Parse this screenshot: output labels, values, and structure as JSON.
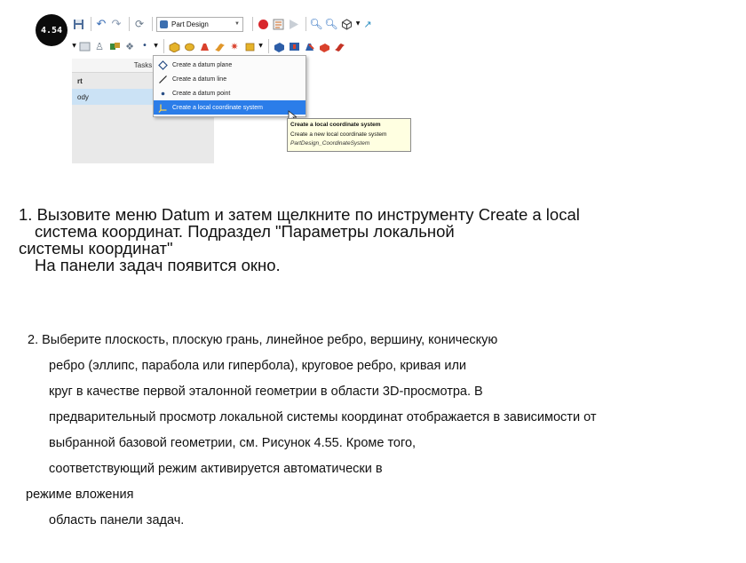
{
  "screenshot": {
    "badge": "4.54",
    "toolbar": {
      "workbench_label": "Part Design"
    },
    "tasks_panel": {
      "header": "Tasks",
      "rows": [
        "rt",
        "ody"
      ]
    },
    "datum_menu": {
      "items": [
        {
          "label": "Create a datum plane",
          "icon": "datum-plane-icon",
          "highlighted": false
        },
        {
          "label": "Create a datum line",
          "icon": "datum-line-icon",
          "highlighted": false
        },
        {
          "label": "Create a datum point",
          "icon": "datum-point-icon",
          "highlighted": false
        },
        {
          "label": "Create a local coordinate system",
          "icon": "coordinate-system-icon",
          "highlighted": true
        }
      ]
    },
    "tooltip": {
      "title": "Create a local coordinate system",
      "description": "Create a new local coordinate system",
      "command": "PartDesign_CoordinateSystem"
    },
    "colors": {
      "menu_highlight": "#2b7de9",
      "tooltip_bg": "#ffffe1",
      "badge_bg": "#0b0b0b"
    }
  },
  "instructions": {
    "step1": [
      "1. Вызовите меню Datum и затем щелкните по инструменту Create a local",
      "система координат. Подраздел \"Параметры локальной",
      "системы координат\"",
      "На панели задач появится окно."
    ],
    "step2": [
      "2. Выберите плоскость, плоскую грань, линейное ребро, вершину, коническую",
      "ребро (эллипс, парабола или гипербола), круговое ребро, кривая или",
      "круг в качестве первой эталонной геометрии в области 3D-просмотра. В",
      "предварительный просмотр локальной системы координат отображается в зависимости от",
      "выбранной базовой геометрии, см. Рисунок 4.55. Кроме того,",
      "соответствующий режим активируется автоматически в",
      "режиме вложения",
      "область панели задач."
    ]
  }
}
